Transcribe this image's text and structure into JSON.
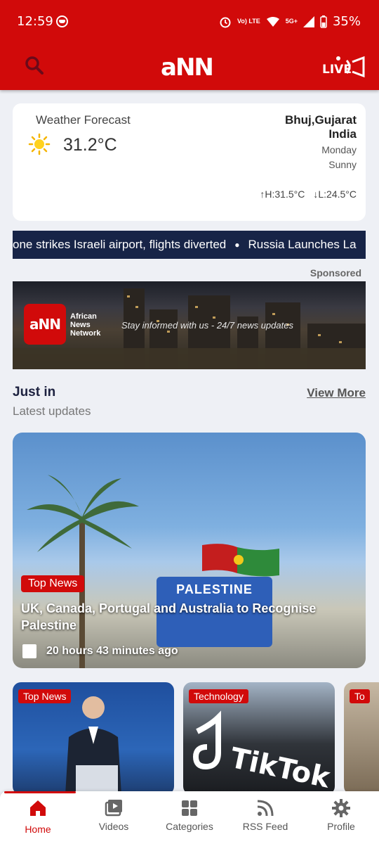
{
  "status_bar": {
    "time": "12:59",
    "network": "Vo) LTE",
    "five_g": "5G+",
    "battery": "35%"
  },
  "header": {
    "logo": "aNN",
    "live_label": "LIVE"
  },
  "weather": {
    "title": "Weather Forecast",
    "temperature": "31.2°C",
    "city": "Bhuj,Gujarat",
    "country": "India",
    "day": "Monday",
    "condition": "Sunny",
    "high": "H:31.5°C",
    "low": "L:24.5°C"
  },
  "ticker": {
    "items": [
      "one strikes Israeli airport, flights diverted",
      "Russia Launches La"
    ]
  },
  "sponsored": {
    "label": "Sponsored",
    "logo": "aNN",
    "brand_line1": "African",
    "brand_line2": "News",
    "brand_line3": "Network",
    "tagline": "Stay informed with us - 24/7 news updates"
  },
  "just_in": {
    "title": "Just in",
    "subtitle": "Latest updates",
    "view_more": "View More"
  },
  "hero": {
    "badge": "Top News",
    "title": "UK, Canada, Portugal and Australia to Recognise Palestine",
    "sign_text": "PALESTINE",
    "time": "20 hours 43 minutes ago"
  },
  "cards": [
    {
      "badge": "Top News"
    },
    {
      "badge": "Technology",
      "image_text": "TikTok"
    },
    {
      "badge": "To"
    }
  ],
  "bottom_nav": {
    "items": [
      {
        "label": "Home",
        "icon": "home-icon",
        "active": true
      },
      {
        "label": "Videos",
        "icon": "video-icon"
      },
      {
        "label": "Categories",
        "icon": "grid-icon"
      },
      {
        "label": "RSS Feed",
        "icon": "rss-icon"
      },
      {
        "label": "Profile",
        "icon": "gear-icon"
      }
    ]
  },
  "colors": {
    "brand_red": "#d10a0a",
    "ticker_navy": "#172447"
  }
}
